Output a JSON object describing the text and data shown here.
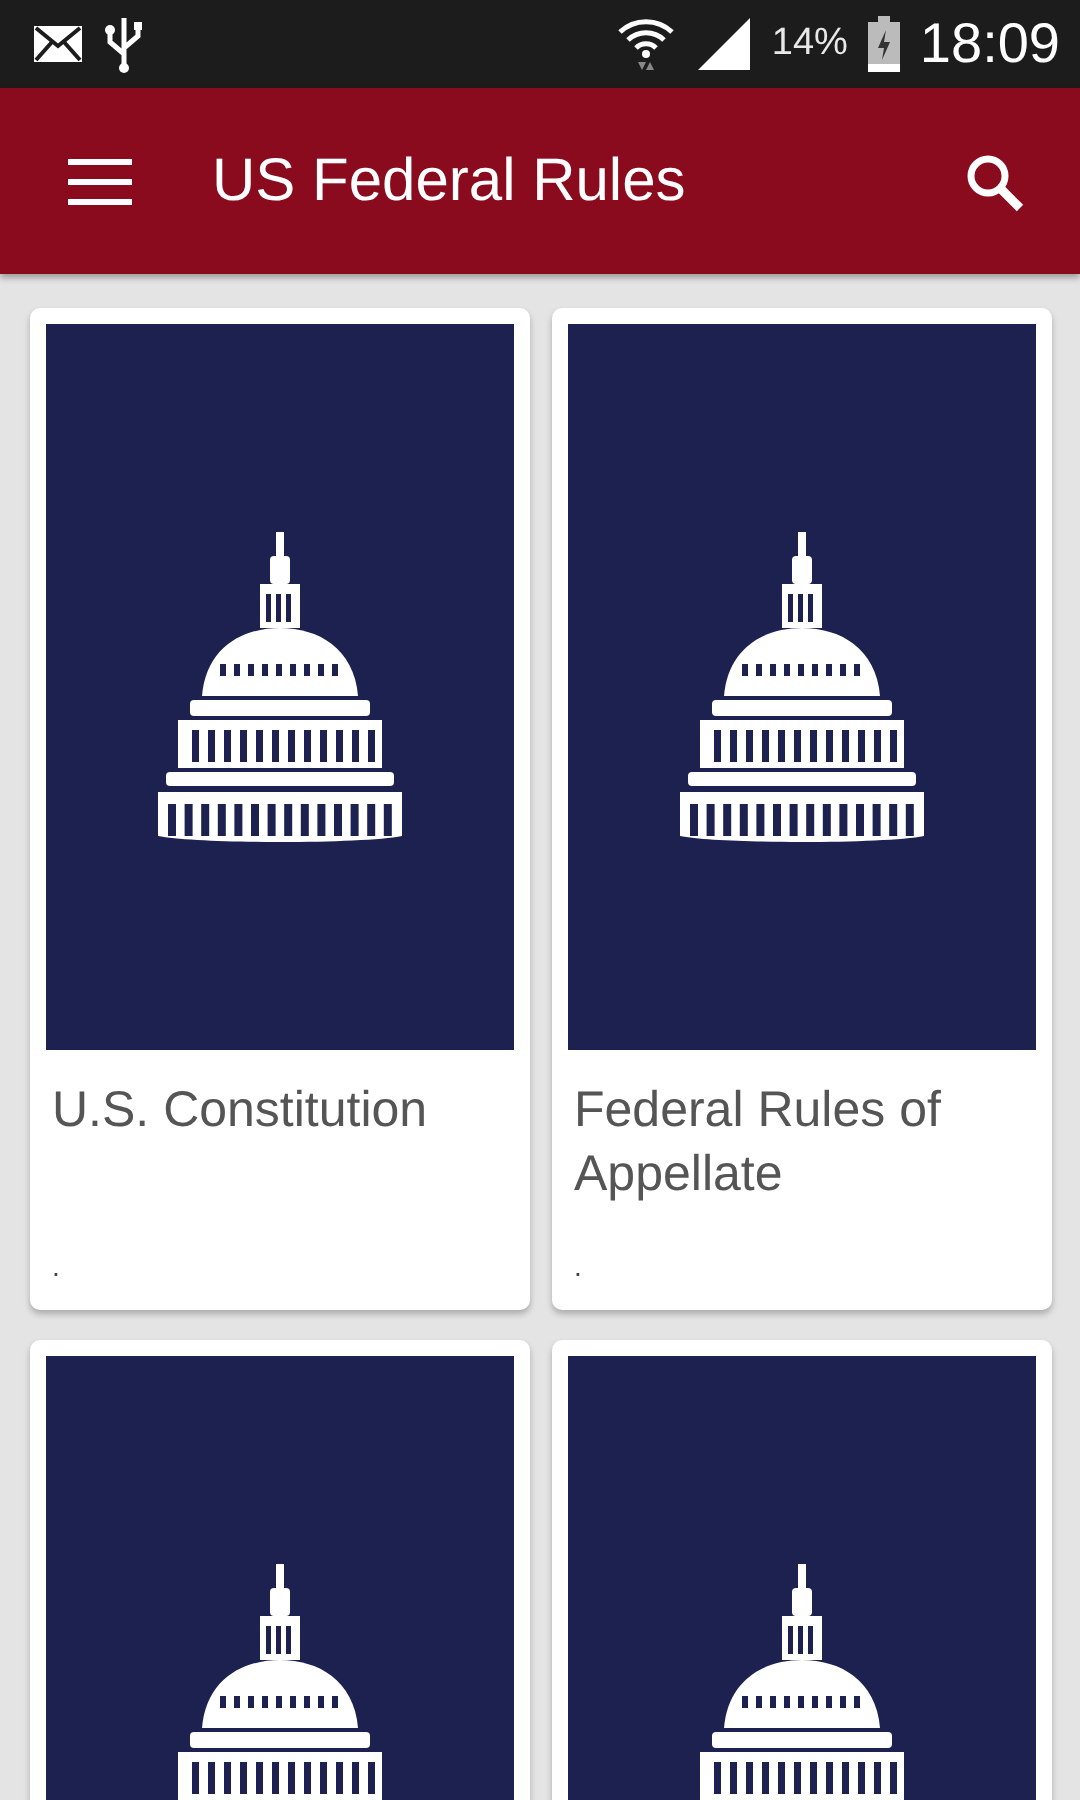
{
  "status_bar": {
    "battery": "14%",
    "time": "18:09"
  },
  "app_bar": {
    "title": "US Federal Rules"
  },
  "cards": [
    {
      "kind": "book",
      "title": "U.S. Constitution",
      "footer": "."
    },
    {
      "kind": "book",
      "title": "Federal Rules of Appellate",
      "footer": "."
    },
    {
      "kind": "book"
    },
    {
      "kind": "book"
    }
  ]
}
